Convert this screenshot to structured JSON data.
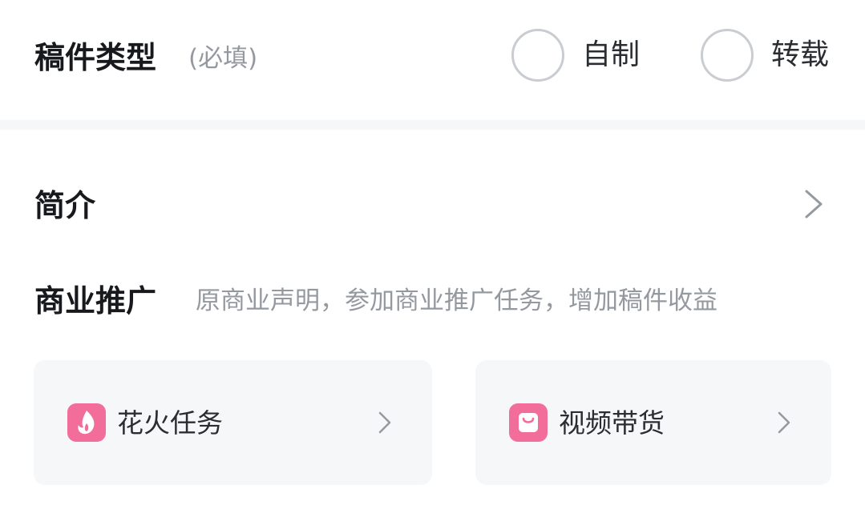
{
  "type_section": {
    "title": "稿件类型",
    "hint": "(必填)",
    "options": [
      {
        "label": "自制",
        "selected": false
      },
      {
        "label": "转载",
        "selected": false
      }
    ]
  },
  "intro_section": {
    "title": "简介",
    "icon": "chevron-right-icon"
  },
  "promo_section": {
    "title": "商业推广",
    "description": "原商业声明，参加商业推广任务，增加稿件收益",
    "cards": [
      {
        "label": "花火任务",
        "icon": "flame-icon"
      },
      {
        "label": "视频带货",
        "icon": "shopping-bag-icon"
      }
    ]
  },
  "colors": {
    "accent_pink": "#f26d99",
    "text_primary": "#18191c",
    "text_muted": "#9499a0",
    "card_bg": "#f6f7f9",
    "radio_border": "#c9ccd0"
  }
}
